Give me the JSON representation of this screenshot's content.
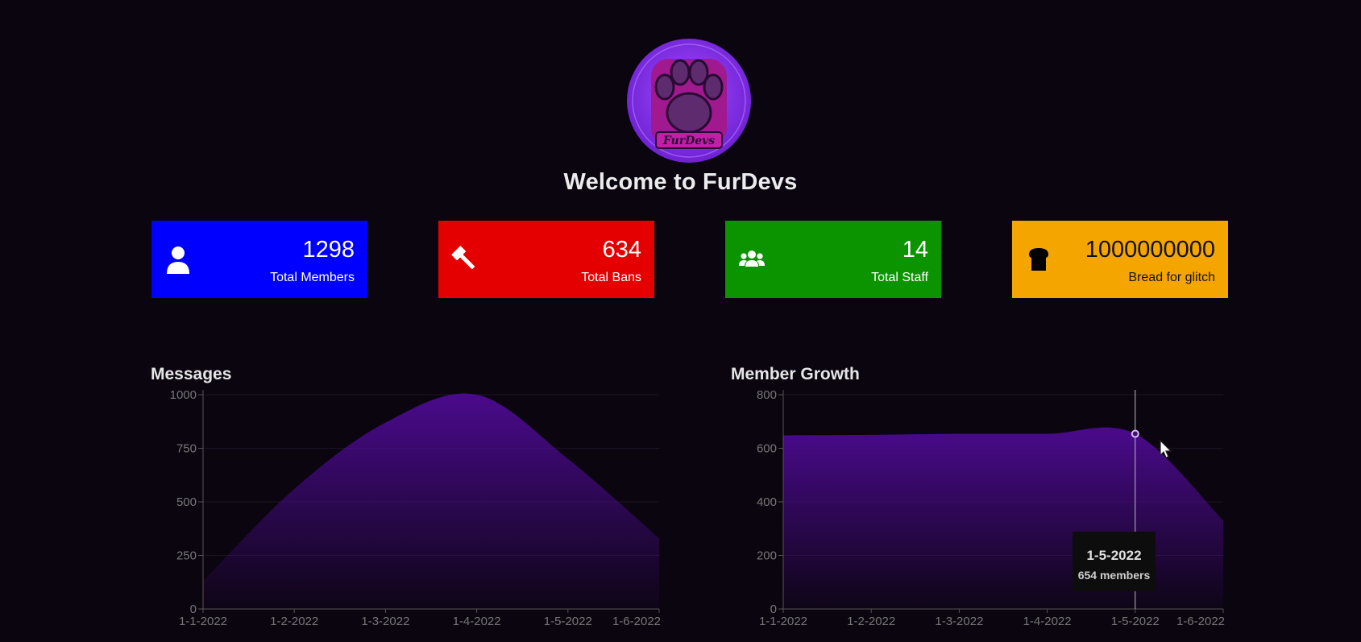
{
  "header": {
    "logo_text": "FurDevs",
    "welcome": "Welcome to FurDevs"
  },
  "stats": [
    {
      "value": "1298",
      "label": "Total Members",
      "icon": "user-icon",
      "color": "#0000ff"
    },
    {
      "value": "634",
      "label": "Total Bans",
      "icon": "gavel-icon",
      "color": "#e50000"
    },
    {
      "value": "14",
      "label": "Total Staff",
      "icon": "users-group-icon",
      "color": "#0b9400"
    },
    {
      "value": "1000000000",
      "label": "Bread for glitch",
      "icon": "bread-icon",
      "color": "#f5a500"
    }
  ],
  "charts": {
    "messages": {
      "title": "Messages"
    },
    "growth": {
      "title": "Member Growth"
    }
  },
  "chart_data": [
    {
      "type": "area",
      "title": "Messages",
      "x": [
        "1-1-2022",
        "1-2-2022",
        "1-3-2022",
        "1-4-2022",
        "1-5-2022",
        "1-6-2022"
      ],
      "series": [
        {
          "values": [
            130,
            560,
            870,
            1000,
            700,
            330
          ]
        }
      ],
      "yticks": [
        0,
        250,
        500,
        750,
        1000
      ],
      "ylim": [
        0,
        1000
      ],
      "grid": true,
      "color": "#4a0a8c"
    },
    {
      "type": "area",
      "title": "Member Growth",
      "x": [
        "1-1-2022",
        "1-2-2022",
        "1-3-2022",
        "1-4-2022",
        "1-5-2022",
        "1-6-2022"
      ],
      "series": [
        {
          "values": [
            648,
            650,
            654,
            654,
            654,
            330
          ]
        }
      ],
      "yticks": [
        0,
        200,
        400,
        600,
        800
      ],
      "ylim": [
        0,
        800
      ],
      "grid": true,
      "color": "#4a0a8c"
    }
  ],
  "tooltip": {
    "date": "1-5-2022",
    "text": "654 members"
  }
}
